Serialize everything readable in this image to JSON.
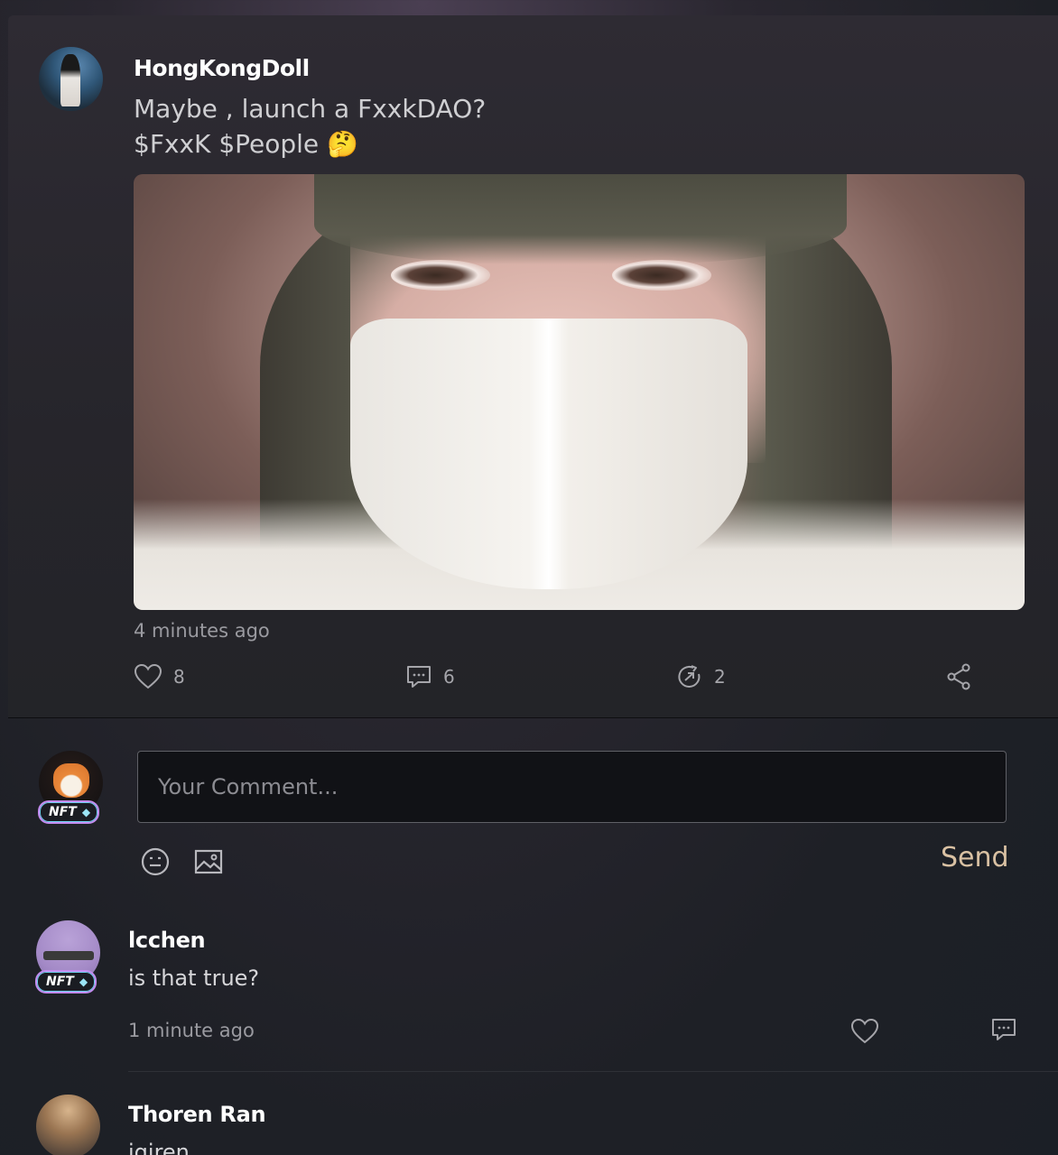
{
  "post": {
    "username": "HongKongDoll",
    "text": "Maybe , launch a FxxkDAO?\n$FxxK $People 🤔",
    "time": "4 minutes ago",
    "likes": "8",
    "comments": "6",
    "reposts": "2"
  },
  "composer": {
    "placeholder": "Your Comment...",
    "send_label": "Send",
    "nft_badge": "NFT"
  },
  "comments": [
    {
      "username": "lcchen",
      "text": "is that true?",
      "time": "1 minute ago",
      "nft_badge": "NFT"
    },
    {
      "username": "Thoren Ran",
      "text": "iqiren"
    }
  ],
  "icons": {
    "like": "heart-icon",
    "comment": "chat-bubble-icon",
    "repost": "repost-icon",
    "share": "share-icon",
    "emoji": "emoji-icon",
    "image": "image-icon"
  },
  "colors": {
    "send": "#d9c1a3",
    "nft_border": "#c48cf0"
  }
}
